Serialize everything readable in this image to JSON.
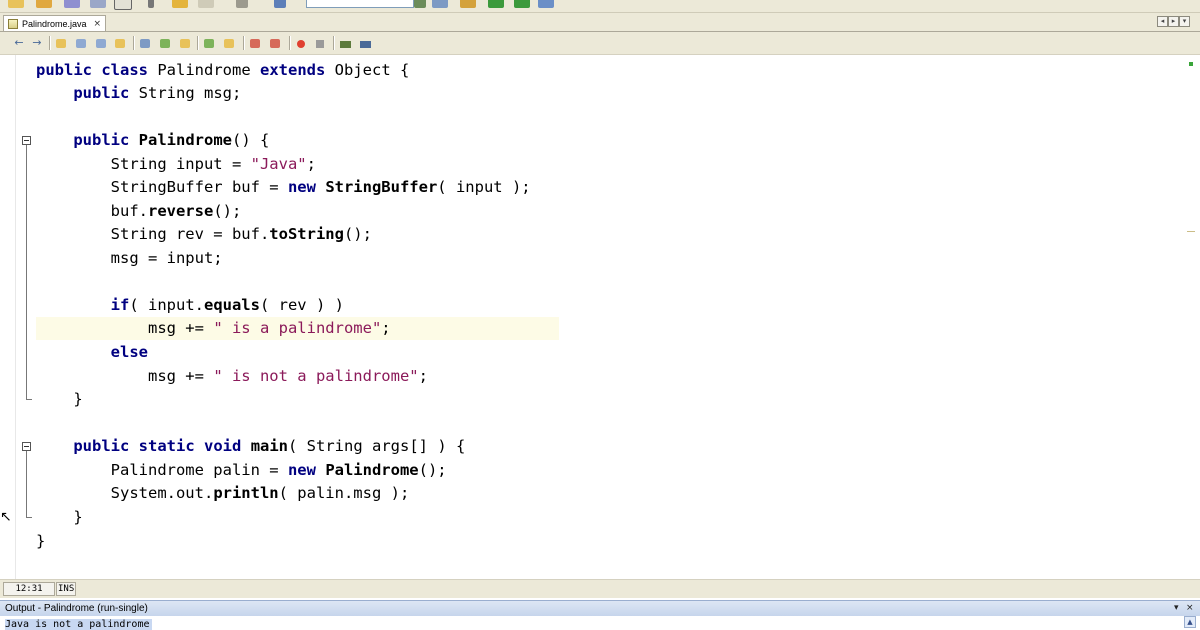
{
  "editor_tab": {
    "label": "Palindrome.java",
    "close": "×"
  },
  "tab_nav": {
    "prev": "◂",
    "next": "▸",
    "menu": "▾"
  },
  "code": {
    "l1": {
      "a": "public",
      "b": " ",
      "c": "class",
      "d": " Palindrome ",
      "e": "extends",
      "f": " Object {"
    },
    "l2": {
      "a": "    ",
      "b": "public",
      "c": " String msg;"
    },
    "l4": {
      "a": "    ",
      "b": "public",
      "c": " ",
      "d": "Palindrome",
      "e": "() {"
    },
    "l5": {
      "a": "        String input = ",
      "b": "\"Java\"",
      "c": ";"
    },
    "l6": {
      "a": "        StringBuffer buf = ",
      "b": "new",
      "c": " ",
      "d": "StringBuffer",
      "e": "( input );"
    },
    "l7": {
      "a": "        buf.",
      "b": "reverse",
      "c": "();"
    },
    "l8": {
      "a": "        String rev = buf.",
      "b": "toString",
      "c": "();"
    },
    "l9": {
      "a": "        msg = input;"
    },
    "l11": {
      "a": "        ",
      "b": "if",
      "c": "( input.",
      "d": "equals",
      "e": "( rev ) )"
    },
    "l12": {
      "a": "            msg += ",
      "b": "\" is a palindrome\"",
      "c": ";"
    },
    "l13": {
      "a": "        ",
      "b": "else"
    },
    "l14": {
      "a": "            msg += ",
      "b": "\" is not a palindrome\"",
      "c": ";"
    },
    "l15": {
      "a": "    }"
    },
    "l17": {
      "a": "    ",
      "b": "public",
      "c": " ",
      "d": "static",
      "e": " ",
      "f": "void",
      "g": " ",
      "h": "main",
      "i": "( String args[] ) {"
    },
    "l18": {
      "a": "        Palindrome palin = ",
      "b": "new",
      "c": " ",
      "d": "Palindrome",
      "e": "();"
    },
    "l19": {
      "a": "        System.out.",
      "b": "println",
      "c": "( palin.msg );"
    },
    "l20": {
      "a": "    }"
    },
    "l21": {
      "a": "}"
    }
  },
  "status": {
    "position": "12:31",
    "mode": "INS"
  },
  "output": {
    "title": "Output - Palindrome (run-single)",
    "minimize": "▾",
    "close": "×",
    "line": "Java is not a palindrome",
    "scroll_up": "▲"
  },
  "icons": {
    "back": "←",
    "forward": "→",
    "cursor": "↖"
  },
  "colors": {
    "keyword": "#000080",
    "string": "#8b1a5a",
    "current_line": "#fdfbe6",
    "chrome": "#ece9d8",
    "output_header": "#c6d5ec"
  }
}
